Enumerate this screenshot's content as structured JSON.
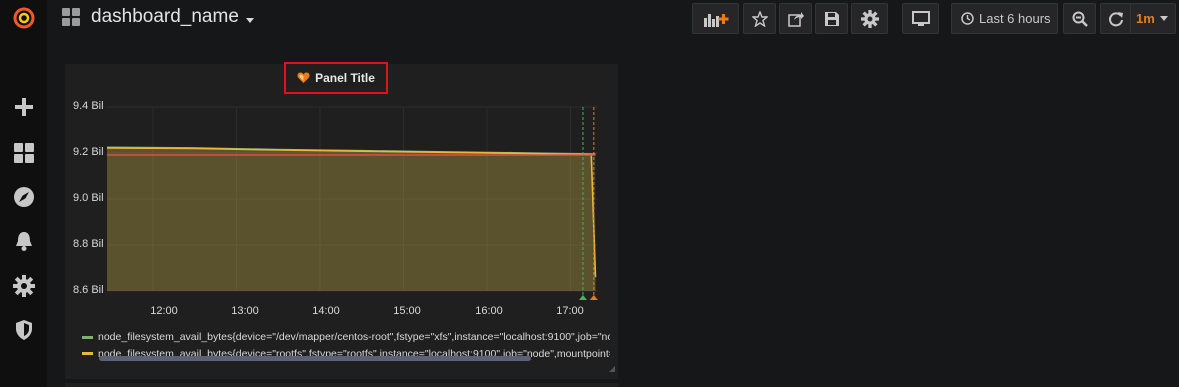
{
  "sidebar": {
    "items": [
      {
        "name": "grafana-logo-icon"
      },
      {
        "name": "plus-icon"
      },
      {
        "name": "dashboards-icon"
      },
      {
        "name": "explore-compass-icon"
      },
      {
        "name": "alerting-bell-icon"
      },
      {
        "name": "configuration-gear-icon"
      },
      {
        "name": "server-admin-shield-icon"
      }
    ]
  },
  "header": {
    "dashboard_title": "dashboard_name",
    "time_range_label": "Last 6 hours",
    "refresh_interval": "1m",
    "buttons": [
      "add-panel-icon",
      "star-icon",
      "share-icon",
      "save-icon",
      "settings-gear-icon",
      "tv-mode-icon",
      "clock-icon",
      "zoom-out-icon",
      "refresh-icon"
    ]
  },
  "colors": {
    "accent_orange": "#eb7b18",
    "series_green": "#7eb26d",
    "series_yellow": "#eab839",
    "threshold_red": "#e24d42",
    "highlight_border": "#e0121b"
  },
  "panel": {
    "title": "Panel Title",
    "title_icon": "heart-icon"
  },
  "chart_data": {
    "type": "line",
    "title": "Panel Title",
    "y_tick_labels": [
      "9.4 Bil",
      "9.2 Bil",
      "9.0 Bil",
      "8.8 Bil",
      "8.6 Bil"
    ],
    "x_tick_labels": [
      "12:00",
      "13:00",
      "14:00",
      "15:00",
      "16:00",
      "17:00"
    ],
    "ylim": [
      8.6,
      9.4
    ],
    "xlim": [
      11.45,
      17.33
    ],
    "grid": true,
    "legend_placement": "bottom",
    "series": [
      {
        "name": "node_filesystem_avail_bytes{device=\"/dev/mapper/centos-root\",fstype=\"xfs\",instance=\"localhost:9100\",job=\"node\",mountpoint=\"/\"}",
        "color": "#7eb26d",
        "x": [
          11.45,
          12.5,
          13.5,
          14.5,
          15.5,
          16.5,
          17.3
        ],
        "y": [
          9.225,
          9.222,
          9.215,
          9.21,
          9.205,
          9.2,
          9.195
        ]
      },
      {
        "name": "node_filesystem_avail_bytes{device=\"rootfs\",fstype=\"rootfs\",instance=\"localhost:9100\",job=\"node\",mountpoint=\"/\"}",
        "color": "#eab839",
        "x": [
          11.45,
          12.5,
          13.5,
          14.5,
          15.5,
          16.5,
          17.25,
          17.3
        ],
        "y": [
          9.222,
          9.22,
          9.213,
          9.208,
          9.203,
          9.198,
          9.193,
          8.66
        ]
      }
    ],
    "thresholds": [
      {
        "value": 9.2,
        "color": "#e24d42"
      }
    ],
    "annotations": [
      {
        "x": 17.15,
        "color": "#3fb950"
      },
      {
        "x": 17.28,
        "color": "#eb7b18"
      }
    ]
  }
}
